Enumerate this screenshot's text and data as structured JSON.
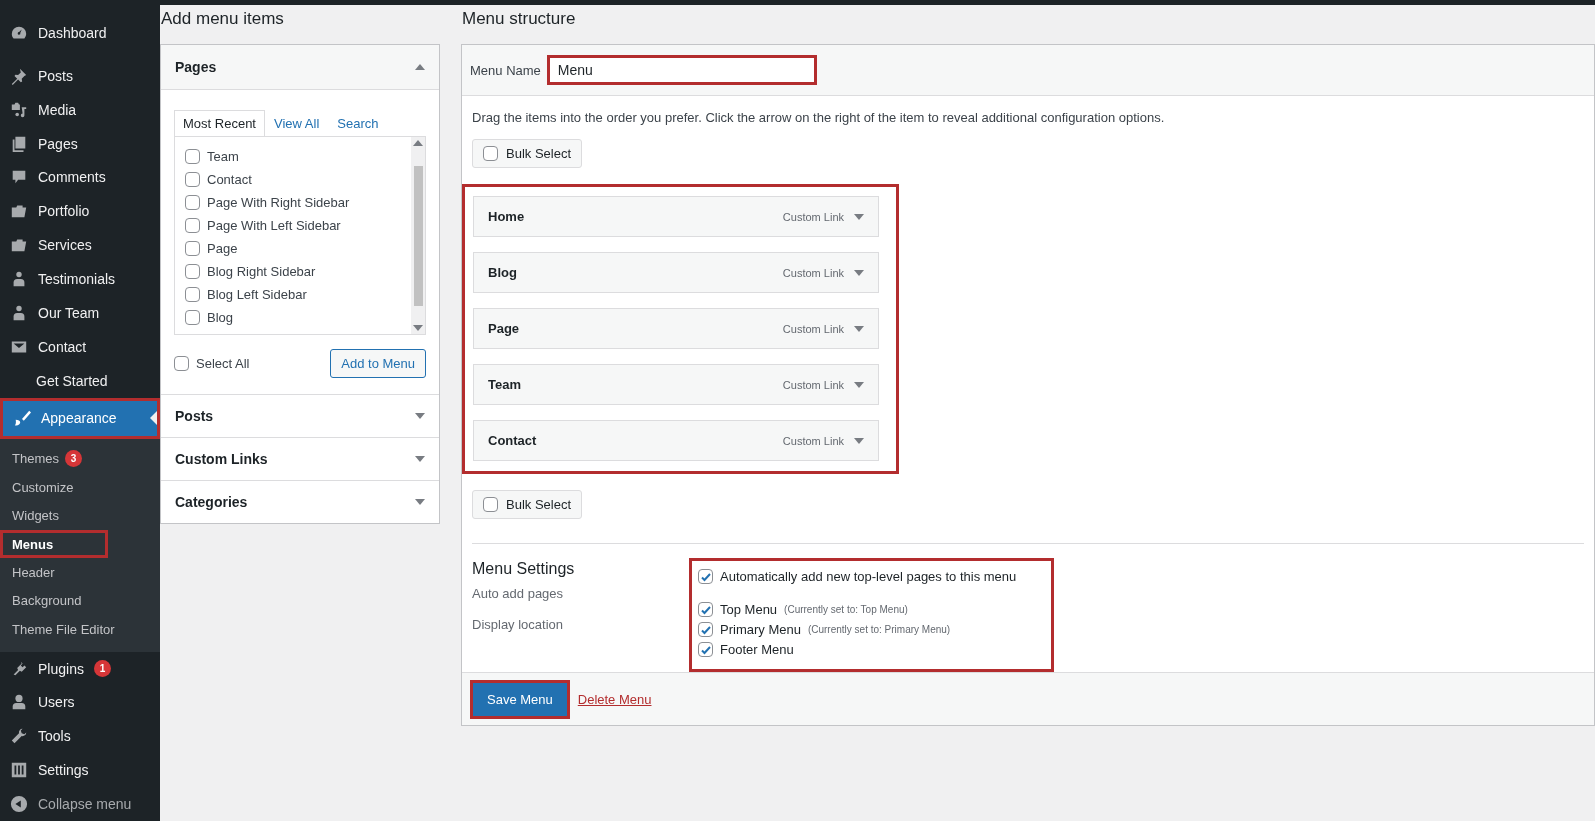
{
  "sidebar": {
    "items": [
      {
        "label": "Dashboard",
        "selected": false
      },
      {
        "label": "Posts",
        "selected": false
      },
      {
        "label": "Media",
        "selected": false
      },
      {
        "label": "Pages",
        "selected": false
      },
      {
        "label": "Comments",
        "selected": false
      },
      {
        "label": "Portfolio",
        "selected": false
      },
      {
        "label": "Services",
        "selected": false
      },
      {
        "label": "Testimonials",
        "selected": false
      },
      {
        "label": "Our Team",
        "selected": false
      },
      {
        "label": "Contact",
        "selected": false
      },
      {
        "label": "Get Started",
        "selected": false
      },
      {
        "label": "Appearance",
        "selected": true,
        "highlighted": true,
        "expanded": true,
        "children": [
          {
            "label": "Themes",
            "badge": "3",
            "selected": false,
            "highlighted": false
          },
          {
            "label": "Customize",
            "selected": false,
            "highlighted": false
          },
          {
            "label": "Widgets",
            "selected": false,
            "highlighted": false
          },
          {
            "label": "Menus",
            "selected": true,
            "highlighted": true
          },
          {
            "label": "Header",
            "selected": false,
            "highlighted": false
          },
          {
            "label": "Background",
            "selected": false,
            "highlighted": false
          },
          {
            "label": "Theme File Editor",
            "selected": false,
            "highlighted": false
          }
        ]
      },
      {
        "label": "Plugins",
        "badge": "1",
        "selected": false
      },
      {
        "label": "Users",
        "selected": false
      },
      {
        "label": "Tools",
        "selected": false
      },
      {
        "label": "Settings",
        "selected": false
      }
    ],
    "collapse": "Collapse menu"
  },
  "add_menu_items": {
    "title": "Add menu items",
    "sections": [
      {
        "title": "Pages",
        "expanded": true,
        "tabs": [
          {
            "label": "Most Recent",
            "selected": true
          },
          {
            "label": "View All",
            "selected": false
          },
          {
            "label": "Search",
            "selected": false
          }
        ],
        "pages": [
          {
            "label": "Team",
            "checked": false
          },
          {
            "label": "Contact",
            "checked": false
          },
          {
            "label": "Page With Right Sidebar",
            "checked": false
          },
          {
            "label": "Page With Left Sidebar",
            "checked": false
          },
          {
            "label": "Page",
            "checked": false
          },
          {
            "label": "Blog Right Sidebar",
            "checked": false
          },
          {
            "label": "Blog Left Sidebar",
            "checked": false
          },
          {
            "label": "Blog",
            "checked": false
          }
        ],
        "select_all": {
          "label": "Select All",
          "checked": false
        },
        "button": "Add to Menu"
      },
      {
        "title": "Posts",
        "expanded": false
      },
      {
        "title": "Custom Links",
        "expanded": false
      },
      {
        "title": "Categories",
        "expanded": false
      }
    ]
  },
  "menu_structure": {
    "title": "Menu structure",
    "menu_name": {
      "label": "Menu Name",
      "value": "Menu",
      "highlighted": true
    },
    "instructions": "Drag the items into the order you prefer. Click the arrow on the right of the item to reveal additional configuration options.",
    "bulk_select_top": {
      "label": "Bulk Select",
      "checked": false
    },
    "items_highlighted": true,
    "items": [
      {
        "title": "Home",
        "type": "Custom Link"
      },
      {
        "title": "Blog",
        "type": "Custom Link"
      },
      {
        "title": "Page",
        "type": "Custom Link"
      },
      {
        "title": "Team",
        "type": "Custom Link"
      },
      {
        "title": "Contact",
        "type": "Custom Link"
      }
    ],
    "bulk_select_bottom": {
      "label": "Bulk Select",
      "checked": false
    },
    "settings": {
      "title": "Menu Settings",
      "highlighted": true,
      "auto_add": {
        "label": "Auto add pages",
        "option": "Automatically add new top-level pages to this menu",
        "checked": true
      },
      "display_location": {
        "label": "Display location",
        "locations": [
          {
            "name": "Top Menu",
            "note": "(Currently set to: Top Menu)",
            "checked": true
          },
          {
            "name": "Primary Menu",
            "note": "(Currently set to: Primary Menu)",
            "checked": true
          },
          {
            "name": "Footer Menu",
            "checked": true
          }
        ]
      }
    },
    "save_button": {
      "label": "Save Menu",
      "highlighted": true
    },
    "delete_link": "Delete Menu"
  }
}
